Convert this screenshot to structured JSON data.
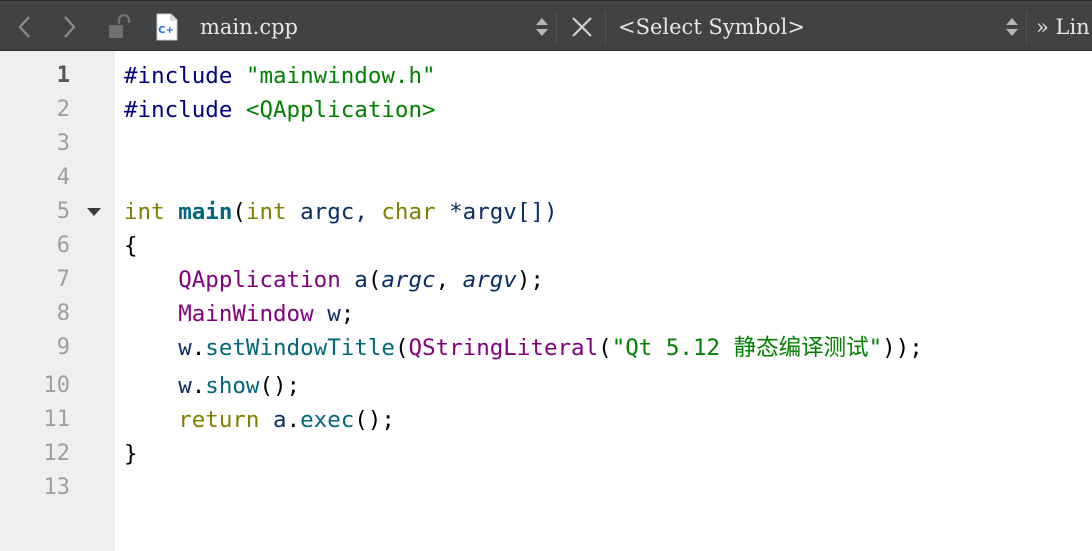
{
  "toolbar": {
    "back_icon": "chevron-left-icon",
    "forward_icon": "chevron-right-icon",
    "lock_icon": "unlocked-icon",
    "file_icon": "cpp-file-icon",
    "file_name": "main.cpp",
    "close_icon": "close-icon",
    "symbol_placeholder": "<Select Symbol>",
    "more_label": "» Lin"
  },
  "editor": {
    "current_line": "1",
    "line_numbers": [
      "1",
      "2",
      "3",
      "4",
      "5",
      "6",
      "7",
      "8",
      "9",
      "10",
      "11",
      "12",
      "13"
    ],
    "lines": {
      "l1": {
        "pp": "#include",
        "sp": " ",
        "str": "\"mainwindow.h\""
      },
      "l2": {
        "pp": "#include",
        "sp": " ",
        "str": "<QApplication>"
      },
      "l5": {
        "kw1": "int",
        "sp1": " ",
        "fn": "main",
        "p1": "(",
        "kw2": "int",
        "a1": " argc, ",
        "kw3": "char",
        "a2": " *argv[])"
      },
      "l6": {
        "text": "{"
      },
      "l7": {
        "indent": "    ",
        "cls": "QApplication",
        "sp": " ",
        "var": "a",
        "p1": "(",
        "par1": "argc",
        "c": ", ",
        "par2": "argv",
        "p2": ");"
      },
      "l8": {
        "indent": "    ",
        "cls": "MainWindow",
        "sp": " ",
        "var": "w",
        "p": ";"
      },
      "l9": {
        "indent": "    ",
        "var": "w",
        "dot": ".",
        "fn": "setWindowTitle",
        "p1": "(",
        "cls": "QStringLiteral",
        "p2": "(",
        "str": "\"Qt 5.12 静态编译测试\"",
        "p3": "));"
      },
      "l10": {
        "indent": "    ",
        "var": "w",
        "dot": ".",
        "fn": "show",
        "p": "();"
      },
      "l11": {
        "indent": "    ",
        "kw": "return",
        "sp": " ",
        "var": "a",
        "dot": ".",
        "fn": "exec",
        "p": "();"
      },
      "l12": {
        "text": "}"
      }
    },
    "fold_icon": "fold-arrow-icon"
  },
  "colors": {
    "toolbar_bg": "#404244",
    "gutter_bg": "#efefef",
    "preprocessor": "#000080",
    "string": "#008000",
    "keyword": "#808000",
    "function": "#00677c",
    "class": "#800080",
    "parameter": "#092e64"
  }
}
